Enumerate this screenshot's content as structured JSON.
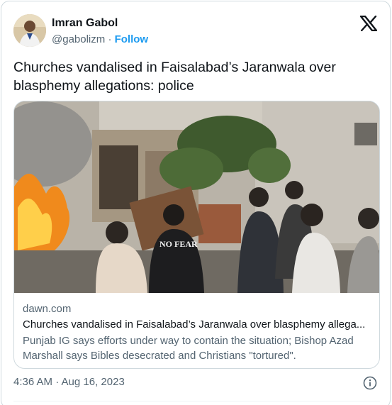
{
  "author": {
    "name": "Imran Gabol",
    "handle": "@gabolizm",
    "separator": "·",
    "follow_label": "Follow"
  },
  "tweet": {
    "text": "Churches vandalised in Faisalabad’s Jaranwala over blasphemy allegations: police",
    "timestamp": "4:36 AM · Aug 16, 2023"
  },
  "link_card": {
    "domain": "dawn.com",
    "title": "Churches vandalised in Faisalabad’s Jaranwala over blasphemy allega...",
    "description": "Punjab IG says efforts under way to contain the situation; Bishop Azad Marshall says Bibles desecrated and Christians \"tortured\".",
    "image_caption_text": "NO FEAR"
  },
  "icons": {
    "brand": "x-logo-icon",
    "info": "info-icon"
  },
  "colors": {
    "link_blue": "#1d9bf0",
    "text_primary": "#0f1419",
    "text_secondary": "#536471",
    "border": "#cfd9de"
  }
}
